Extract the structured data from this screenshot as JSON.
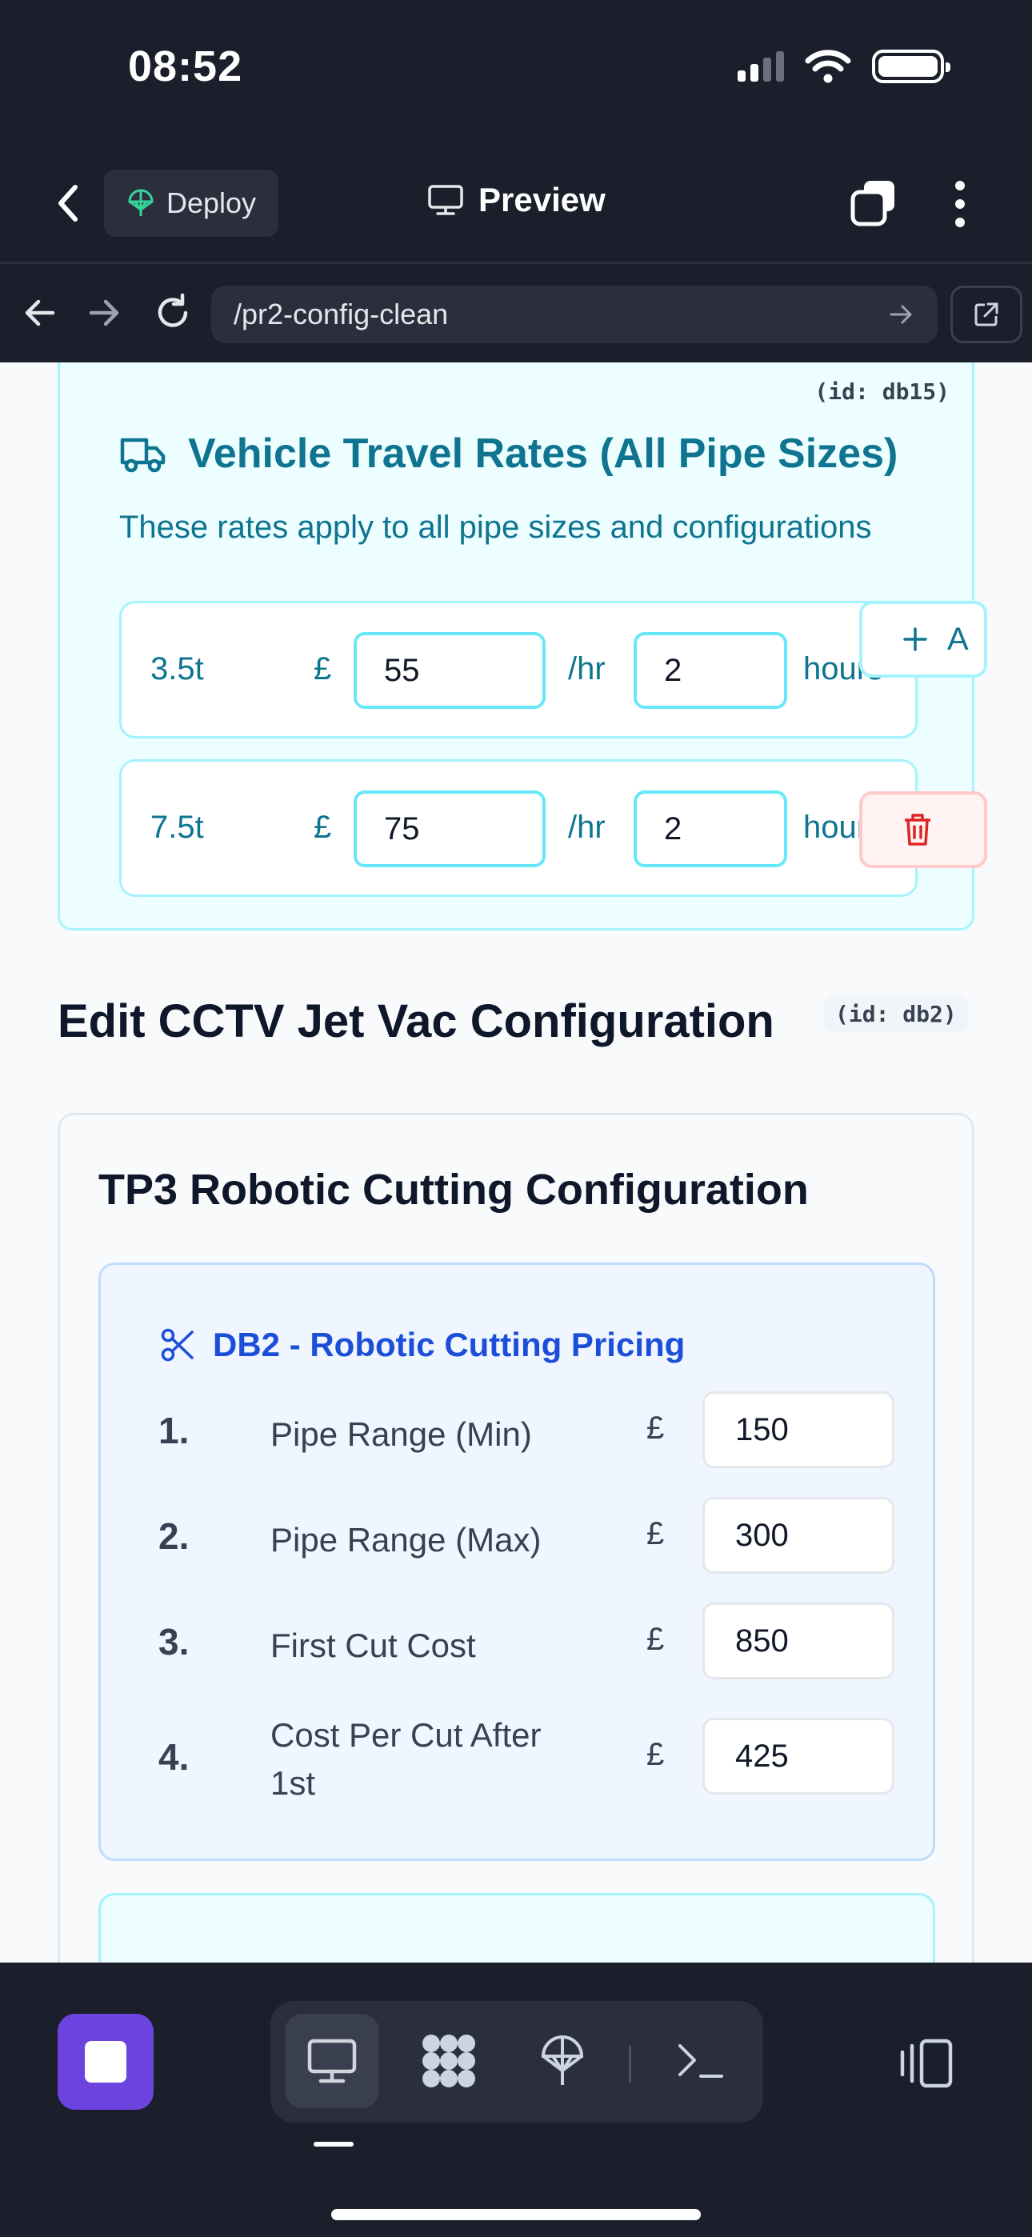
{
  "status": {
    "time": "08:52"
  },
  "header": {
    "deploy_label": "Deploy",
    "preview_label": "Preview"
  },
  "browser": {
    "url": "/pr2-config-clean"
  },
  "travel": {
    "id_tag": "(id: db15)",
    "title": "Vehicle Travel Rates (All Pipe Sizes)",
    "description": "These rates apply to all pipe sizes and configurations",
    "currency": "£",
    "rate_unit": "/hr",
    "hours_unit": "hours",
    "add_label": "A",
    "rows": [
      {
        "size": "3.5t",
        "rate": "55",
        "hours": "2"
      },
      {
        "size": "7.5t",
        "rate": "75",
        "hours": "2"
      }
    ]
  },
  "page": {
    "heading": "Edit CCTV Jet Vac Configuration",
    "id_tag": "(id: db2)"
  },
  "config": {
    "title": "TP3 Robotic Cutting Configuration",
    "pricing_title": "DB2 - Robotic Cutting Pricing",
    "currency": "£",
    "items": [
      {
        "num": "1.",
        "label": "Pipe Range (Min)",
        "value": "150"
      },
      {
        "num": "2.",
        "label": "Pipe Range (Max)",
        "value": "300"
      },
      {
        "num": "3.",
        "label": "First Cut Cost",
        "value": "850"
      },
      {
        "num": "4.",
        "label": "Cost Per Cut After 1st",
        "value": "425"
      }
    ]
  },
  "colors": {
    "accent_cyan": "#0e7490",
    "accent_blue": "#1d4ed8",
    "stop_purple": "#6d43e0",
    "delete_red": "#dc2626"
  },
  "icons": [
    "back-icon",
    "deploy-icon",
    "monitor-icon",
    "tabs-icon",
    "more-icon",
    "arrow-left-icon",
    "arrow-right-icon",
    "reload-icon",
    "open-external-icon",
    "truck-icon",
    "plus-icon",
    "trash-icon",
    "scissors-icon",
    "stop-icon",
    "desktop-icon",
    "grid-icon",
    "deploy-icon",
    "terminal-icon",
    "devices-icon"
  ]
}
